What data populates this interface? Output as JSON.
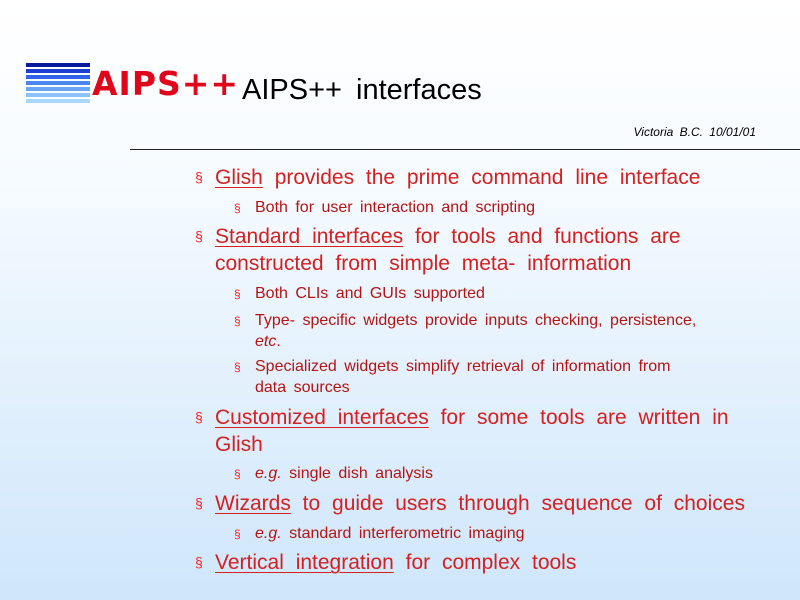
{
  "logo": {
    "text": "AIPS++",
    "stripe_colors": [
      "#0a1a9c",
      "#1c3fd0",
      "#2f63e8",
      "#4a86f0",
      "#6aa6f6",
      "#8cc2fa",
      "#a8d6fc"
    ]
  },
  "title": "AIPS++ interfaces",
  "byline": "Victoria B.C. 10/01/01",
  "bullet_glyph": "§",
  "colors": {
    "title": "#000000",
    "bullet_text": "#d42020",
    "sub_text": "#b41414",
    "bullet_mark": "#ff2020",
    "logo_text": "#e0061b"
  },
  "items": [
    {
      "lines": [
        {
          "link": "Glish",
          "rest": " provides the prime command line interface"
        }
      ],
      "subs": [
        {
          "lines": [
            {
              "pre": "",
              "rest": "Both for user interaction and scripting"
            }
          ]
        }
      ]
    },
    {
      "lines": [
        {
          "link": "Standard interfaces",
          "rest": " for tools and functions are"
        },
        {
          "rest": "constructed from simple meta- information"
        }
      ],
      "subs": [
        {
          "lines": [
            {
              "rest": "Both CLIs and GUIs supported"
            }
          ]
        },
        {
          "lines": [
            {
              "rest": "Type- specific widgets provide inputs checking, persistence,"
            },
            {
              "italic": "etc",
              "rest": "."
            }
          ]
        },
        {
          "lines": [
            {
              "rest": "Specialized widgets simplify retrieval of information from"
            },
            {
              "rest": "data sources"
            }
          ]
        }
      ]
    },
    {
      "lines": [
        {
          "link": "Customized interfaces",
          "rest": " for some tools are written in"
        },
        {
          "rest": "Glish"
        }
      ],
      "subs": [
        {
          "lines": [
            {
              "italic": "e.g.",
              "rest": " single dish analysis"
            }
          ]
        }
      ]
    },
    {
      "lines": [
        {
          "link": "Wizards",
          "rest": " to guide users through sequence of choices"
        }
      ],
      "subs": [
        {
          "lines": [
            {
              "italic": "e.g.",
              "rest": " standard interferometric imaging"
            }
          ]
        }
      ]
    },
    {
      "lines": [
        {
          "link": "Vertical integration",
          "rest": " for complex tools"
        }
      ],
      "subs": []
    }
  ]
}
